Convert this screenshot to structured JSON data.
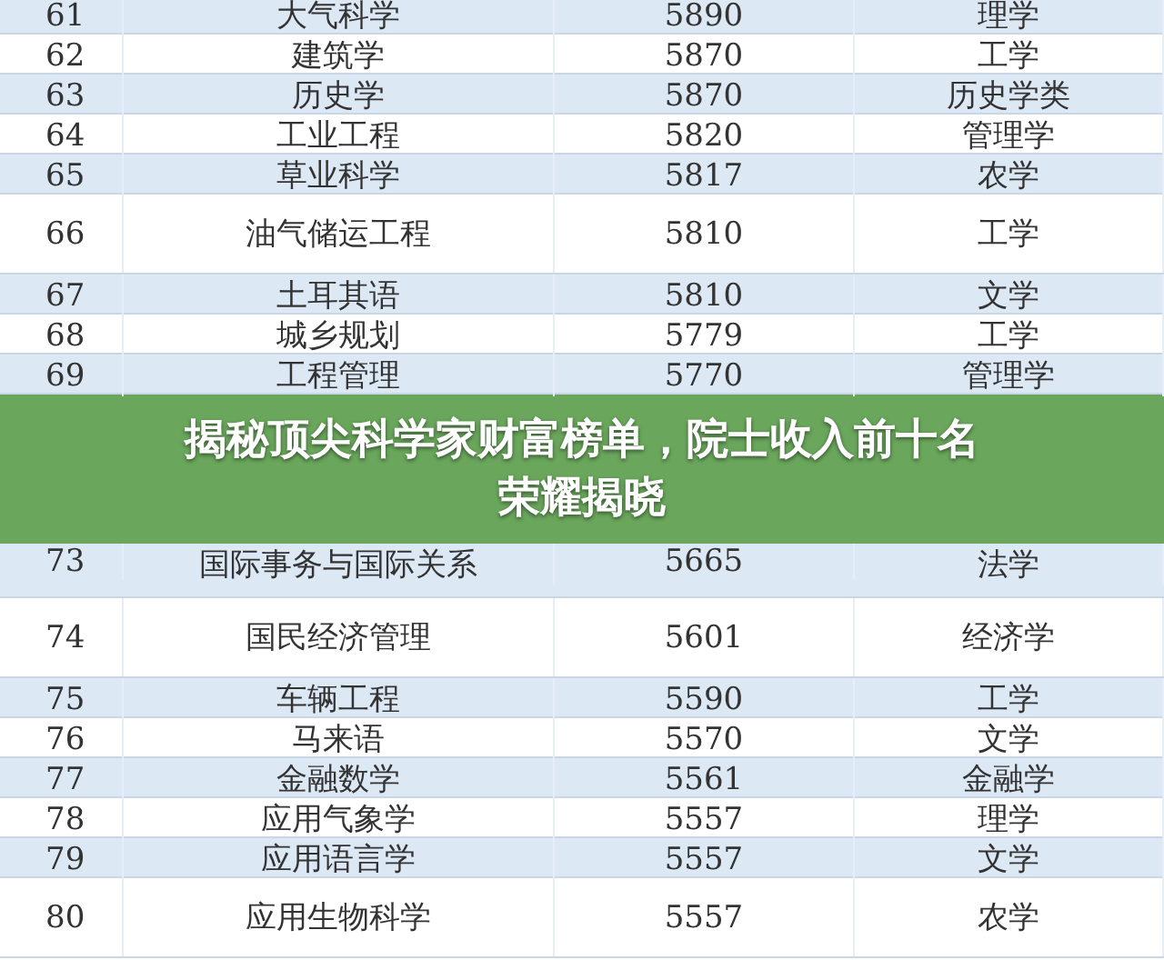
{
  "table": {
    "rows_above": [
      {
        "rank": "61",
        "major": "大气科学",
        "score": "5890",
        "category": "理学",
        "kind": "normal"
      },
      {
        "rank": "62",
        "major": "建筑学",
        "score": "5870",
        "category": "工学",
        "kind": "normal"
      },
      {
        "rank": "63",
        "major": "历史学",
        "score": "5870",
        "category": "历史学类",
        "kind": "normal"
      },
      {
        "rank": "64",
        "major": "工业工程",
        "score": "5820",
        "category": "管理学",
        "kind": "normal"
      },
      {
        "rank": "65",
        "major": "草业科学",
        "score": "5817",
        "category": "农学",
        "kind": "normal"
      },
      {
        "rank": "66",
        "major": "油气储运工程",
        "score": "5810",
        "category": "工学",
        "kind": "tall"
      },
      {
        "rank": "67",
        "major": "土耳其语",
        "score": "5810",
        "category": "文学",
        "kind": "normal"
      },
      {
        "rank": "68",
        "major": "城乡规划",
        "score": "5779",
        "category": "工学",
        "kind": "normal"
      },
      {
        "rank": "69",
        "major": "工程管理",
        "score": "5770",
        "category": "管理学",
        "kind": "normal"
      }
    ],
    "rows_below": [
      {
        "rank": "73",
        "major": "国际事务与国际关系",
        "score": "5665",
        "category": "法学",
        "kind": "lower"
      },
      {
        "rank": "74",
        "major": "国民经济管理",
        "score": "5601",
        "category": "经济学",
        "kind": "tall"
      },
      {
        "rank": "75",
        "major": "车辆工程",
        "score": "5590",
        "category": "工学",
        "kind": "normal"
      },
      {
        "rank": "76",
        "major": "马来语",
        "score": "5570",
        "category": "文学",
        "kind": "normal"
      },
      {
        "rank": "77",
        "major": "金融数学",
        "score": "5561",
        "category": "金融学",
        "kind": "normal"
      },
      {
        "rank": "78",
        "major": "应用气象学",
        "score": "5557",
        "category": "理学",
        "kind": "normal"
      },
      {
        "rank": "79",
        "major": "应用语言学",
        "score": "5557",
        "category": "文学",
        "kind": "normal"
      },
      {
        "rank": "80",
        "major": "应用生物科学",
        "score": "5557",
        "category": "农学",
        "kind": "tall"
      }
    ]
  },
  "banner": {
    "title": "揭秘顶尖科学家财富榜单，院士收入前十名荣耀揭晓"
  }
}
